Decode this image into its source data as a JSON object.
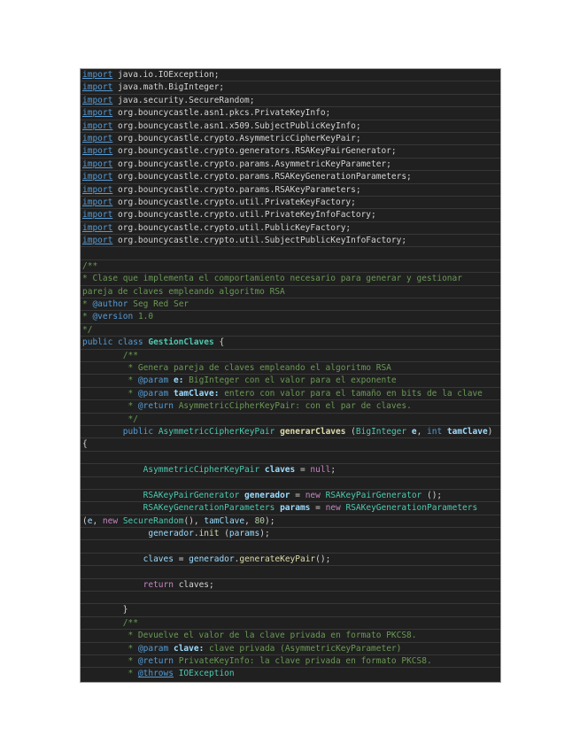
{
  "page": {
    "background": "#ffffff"
  },
  "editor": {
    "language_hint": "java-source-listing",
    "background": "#202020",
    "border_color": "#a0a0a0",
    "separator_color": "#373737",
    "palette": {
      "plain": "#d4d4d4",
      "kw": "#569cd6",
      "type": "#4ec9b0",
      "func": "#dcdcaa",
      "var": "#9cdcfe",
      "comment": "#6a9955",
      "ctrl": "#c586c0",
      "num": "#b5cea8"
    },
    "rows": [
      {
        "segments": [
          [
            "kw",
            "import",
            "u"
          ],
          [
            "plain",
            " java.io.IOException;"
          ]
        ]
      },
      {
        "segments": [
          [
            "kw",
            "import",
            "u"
          ],
          [
            "plain",
            " java.math.BigInteger;"
          ]
        ]
      },
      {
        "segments": [
          [
            "kw",
            "import",
            "u"
          ],
          [
            "plain",
            " java.security.SecureRandom;"
          ]
        ]
      },
      {
        "segments": [
          [
            "kw",
            "import",
            "u"
          ],
          [
            "plain",
            " org.bouncycastle.asn1.pkcs.PrivateKeyInfo;"
          ]
        ]
      },
      {
        "segments": [
          [
            "kw",
            "import",
            "u"
          ],
          [
            "plain",
            " org.bouncycastle.asn1.x509.SubjectPublicKeyInfo;"
          ]
        ]
      },
      {
        "segments": [
          [
            "kw",
            "import",
            "u"
          ],
          [
            "plain",
            " org.bouncycastle.crypto.AsymmetricCipherKeyPair;"
          ]
        ]
      },
      {
        "segments": [
          [
            "kw",
            "import",
            "u"
          ],
          [
            "plain",
            " org.bouncycastle.crypto.generators.RSAKeyPairGenerator;"
          ]
        ]
      },
      {
        "segments": [
          [
            "kw",
            "import",
            "u"
          ],
          [
            "plain",
            " org.bouncycastle.crypto.params.AsymmetricKeyParameter;"
          ]
        ]
      },
      {
        "segments": [
          [
            "kw",
            "import",
            "u"
          ],
          [
            "plain",
            " org.bouncycastle.crypto.params.RSAKeyGenerationParameters;"
          ]
        ]
      },
      {
        "segments": [
          [
            "kw",
            "import",
            "u"
          ],
          [
            "plain",
            " org.bouncycastle.crypto.params.RSAKeyParameters;"
          ]
        ]
      },
      {
        "segments": [
          [
            "kw",
            "import",
            "u"
          ],
          [
            "plain",
            " org.bouncycastle.crypto.util.PrivateKeyFactory;"
          ]
        ]
      },
      {
        "segments": [
          [
            "kw",
            "import",
            "u"
          ],
          [
            "plain",
            " org.bouncycastle.crypto.util.PrivateKeyInfoFactory;"
          ]
        ]
      },
      {
        "segments": [
          [
            "kw",
            "import",
            "u"
          ],
          [
            "plain",
            " org.bouncycastle.crypto.util.PublicKeyFactory;"
          ]
        ]
      },
      {
        "segments": [
          [
            "kw",
            "import",
            "u"
          ],
          [
            "plain",
            " org.bouncycastle.crypto.util.SubjectPublicKeyInfoFactory;"
          ]
        ]
      },
      {
        "segments": []
      },
      {
        "segments": [
          [
            "comment",
            "/**"
          ]
        ]
      },
      {
        "segments": [
          [
            "comment",
            "* Clase que implementa el comportamiento necesario para generar y gestionar"
          ]
        ]
      },
      {
        "segments": [
          [
            "comment",
            "pareja de claves empleando algoritmo RSA"
          ]
        ]
      },
      {
        "segments": [
          [
            "comment",
            "* "
          ],
          [
            "kw",
            "@author"
          ],
          [
            "comment",
            " Seg Red Ser"
          ]
        ]
      },
      {
        "segments": [
          [
            "comment",
            "* "
          ],
          [
            "kw",
            "@version"
          ],
          [
            "comment",
            " 1.0"
          ]
        ]
      },
      {
        "segments": [
          [
            "comment",
            "*/"
          ]
        ]
      },
      {
        "segments": [
          [
            "kw",
            "public class "
          ],
          [
            "type",
            "GestionClaves",
            "b"
          ],
          [
            "plain",
            " {"
          ]
        ]
      },
      {
        "segments": [
          [
            "comment",
            "        /**"
          ]
        ]
      },
      {
        "segments": [
          [
            "comment",
            "         * Genera pareja de claves empleando el algoritmo RSA"
          ]
        ]
      },
      {
        "segments": [
          [
            "comment",
            "         * "
          ],
          [
            "kw",
            "@param"
          ],
          [
            "comment",
            " "
          ],
          [
            "var",
            "e:",
            "b"
          ],
          [
            "comment",
            " BigInteger con el valor para el exponente"
          ]
        ]
      },
      {
        "segments": [
          [
            "comment",
            "         * "
          ],
          [
            "kw",
            "@param"
          ],
          [
            "comment",
            " "
          ],
          [
            "var",
            "tamClave:",
            "b"
          ],
          [
            "comment",
            " entero con valor para el tamaño en bits de la clave"
          ]
        ]
      },
      {
        "segments": [
          [
            "comment",
            "         * "
          ],
          [
            "kw",
            "@return"
          ],
          [
            "comment",
            " AsymmetricCipherKeyPair: con el par de claves."
          ]
        ]
      },
      {
        "segments": [
          [
            "comment",
            "         */"
          ]
        ]
      },
      {
        "segments": [
          [
            "plain",
            "        "
          ],
          [
            "kw",
            "public "
          ],
          [
            "type",
            "AsymmetricCipherKeyPair "
          ],
          [
            "func",
            "generarClaves",
            "b"
          ],
          [
            "plain",
            " ("
          ],
          [
            "type",
            "BigInteger "
          ],
          [
            "var",
            "e",
            "b"
          ],
          [
            "plain",
            ", "
          ],
          [
            "kw",
            "int "
          ],
          [
            "var",
            "tamClave",
            "b"
          ],
          [
            "plain",
            ")"
          ]
        ]
      },
      {
        "segments": [
          [
            "plain",
            "{"
          ]
        ]
      },
      {
        "segments": []
      },
      {
        "segments": [
          [
            "plain",
            "            "
          ],
          [
            "type",
            "AsymmetricCipherKeyPair "
          ],
          [
            "var",
            "claves",
            "b"
          ],
          [
            "plain",
            " = "
          ],
          [
            "ctrl",
            "null"
          ],
          [
            "plain",
            ";"
          ]
        ]
      },
      {
        "segments": []
      },
      {
        "segments": [
          [
            "plain",
            "            "
          ],
          [
            "type",
            "RSAKeyPairGenerator "
          ],
          [
            "var",
            "generador",
            "b"
          ],
          [
            "plain",
            " = "
          ],
          [
            "ctrl",
            "new"
          ],
          [
            "plain",
            " "
          ],
          [
            "type",
            "RSAKeyPairGenerator"
          ],
          [
            "plain",
            " ();"
          ]
        ]
      },
      {
        "segments": [
          [
            "plain",
            "            "
          ],
          [
            "type",
            "RSAKeyGenerationParameters "
          ],
          [
            "var",
            "params",
            "b"
          ],
          [
            "plain",
            " = "
          ],
          [
            "ctrl",
            "new"
          ],
          [
            "plain",
            " "
          ],
          [
            "type",
            "RSAKeyGenerationParameters"
          ]
        ]
      },
      {
        "segments": [
          [
            "plain",
            "("
          ],
          [
            "var",
            "e"
          ],
          [
            "plain",
            ", "
          ],
          [
            "ctrl",
            "new"
          ],
          [
            "plain",
            " "
          ],
          [
            "type",
            "SecureRandom"
          ],
          [
            "plain",
            "(), "
          ],
          [
            "var",
            "tamClave"
          ],
          [
            "plain",
            ", "
          ],
          [
            "num",
            "80"
          ],
          [
            "plain",
            ");"
          ]
        ]
      },
      {
        "segments": [
          [
            "plain",
            "             "
          ],
          [
            "var",
            "generador"
          ],
          [
            "plain",
            "."
          ],
          [
            "func",
            "init"
          ],
          [
            "plain",
            " ("
          ],
          [
            "var",
            "params"
          ],
          [
            "plain",
            ");"
          ]
        ]
      },
      {
        "segments": []
      },
      {
        "segments": [
          [
            "plain",
            "            "
          ],
          [
            "var",
            "claves"
          ],
          [
            "plain",
            " = "
          ],
          [
            "var",
            "generador"
          ],
          [
            "plain",
            "."
          ],
          [
            "func",
            "generateKeyPair"
          ],
          [
            "plain",
            "();"
          ]
        ]
      },
      {
        "segments": []
      },
      {
        "segments": [
          [
            "plain",
            "            "
          ],
          [
            "ctrl",
            "return"
          ],
          [
            "plain",
            " claves;"
          ]
        ]
      },
      {
        "segments": []
      },
      {
        "segments": [
          [
            "plain",
            "        }"
          ]
        ]
      },
      {
        "segments": [
          [
            "comment",
            "        /**"
          ]
        ]
      },
      {
        "segments": [
          [
            "comment",
            "         * Devuelve el valor de la clave privada en formato PKCS8."
          ]
        ]
      },
      {
        "segments": [
          [
            "comment",
            "         * "
          ],
          [
            "kw",
            "@param"
          ],
          [
            "comment",
            " "
          ],
          [
            "var",
            "clave:",
            "b"
          ],
          [
            "comment",
            " clave privada (AsymmetricKeyParameter)"
          ]
        ]
      },
      {
        "segments": [
          [
            "comment",
            "         * "
          ],
          [
            "kw",
            "@return"
          ],
          [
            "comment",
            " PrivateKeyInfo: la clave privada en formato PKCS8."
          ]
        ]
      },
      {
        "segments": [
          [
            "comment",
            "         * "
          ],
          [
            "kw",
            "@throws",
            "u"
          ],
          [
            "comment",
            " "
          ],
          [
            "type",
            "IOException"
          ]
        ]
      }
    ]
  }
}
